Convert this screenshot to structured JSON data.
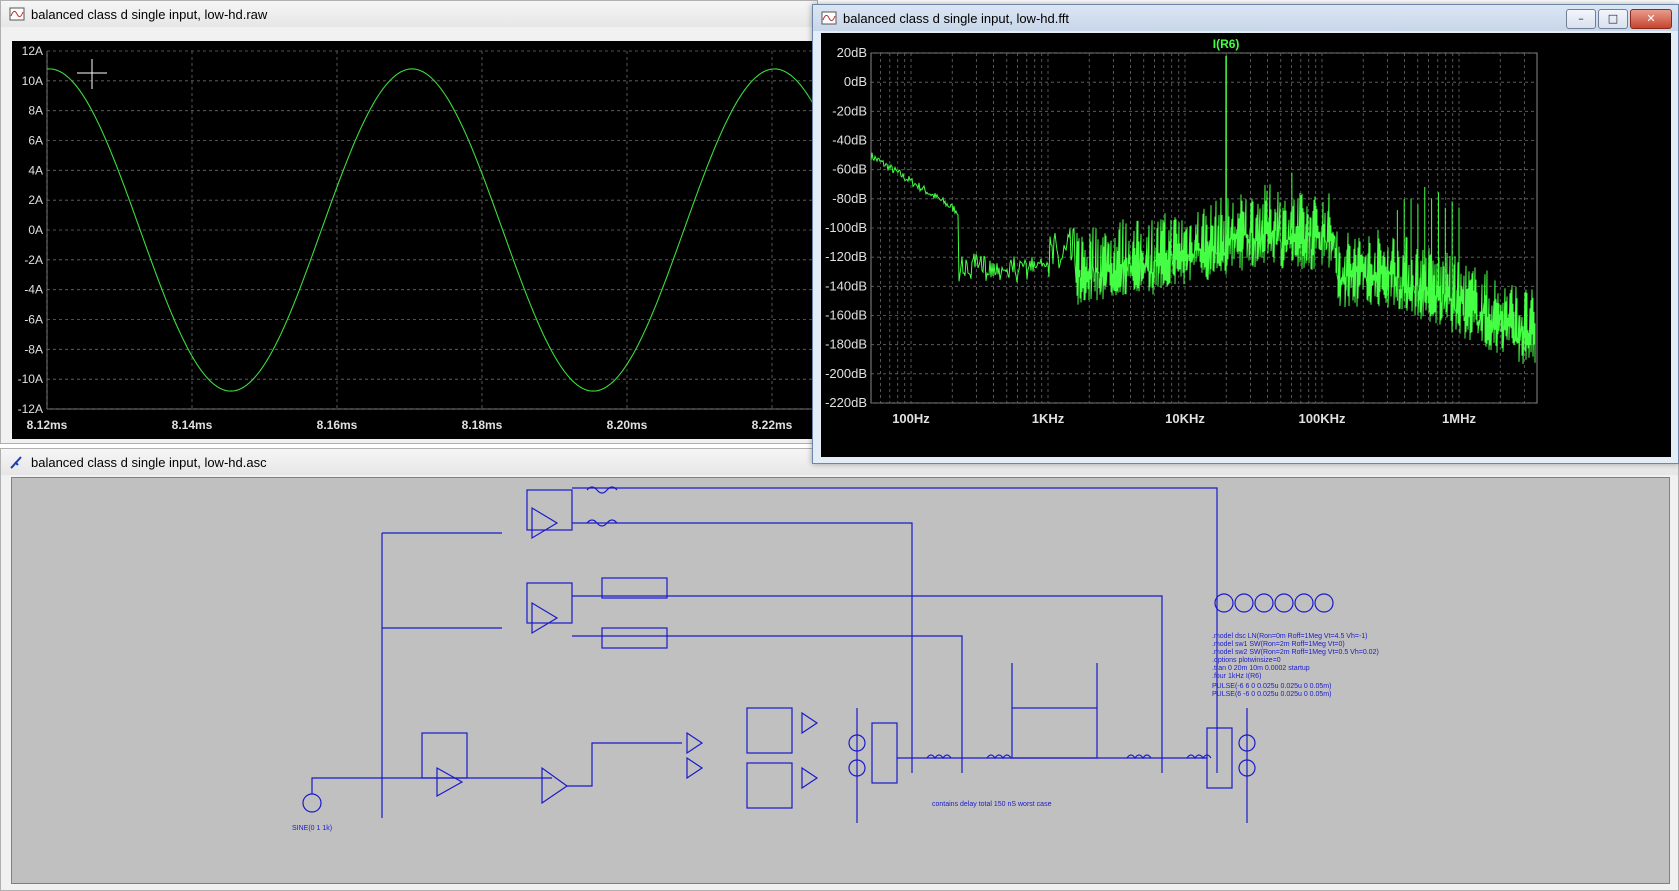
{
  "waveform_window": {
    "title": "balanced class d single input, low-hd.raw",
    "y_ticks": [
      "12A",
      "10A",
      "8A",
      "6A",
      "4A",
      "2A",
      "0A",
      "-2A",
      "-4A",
      "-6A",
      "-8A",
      "-10A",
      "-12A"
    ],
    "x_ticks": [
      "8.12ms",
      "8.14ms",
      "8.16ms",
      "8.18ms",
      "8.20ms",
      "8.22ms"
    ],
    "trace_color": "#3cdc3c"
  },
  "fft_window": {
    "title": "balanced class d single input, low-hd.fft",
    "trace_label": "I(R6)",
    "y_ticks": [
      "20dB",
      "0dB",
      "-20dB",
      "-40dB",
      "-60dB",
      "-80dB",
      "-100dB",
      "-120dB",
      "-140dB",
      "-160dB",
      "-180dB",
      "-200dB",
      "-220dB"
    ],
    "x_ticks": [
      "100Hz",
      "1KHz",
      "10KHz",
      "100KHz",
      "1MHz"
    ],
    "buttons": {
      "minimize": "–",
      "maximize": "□",
      "close": "✕"
    },
    "trace_color": "#44ff44"
  },
  "schematic_window": {
    "title": "balanced class d single input, low-hd.asc",
    "wire_color": "#1a1acc",
    "note": "contains delay total 150 nS worst case",
    "directives": [
      ".model dsc LN(Ron=0m Roff=1Meg Vt=4.5 Vh=-1)",
      ".model sw1 SW(Ron=2m Roff=1Meg Vt=0)",
      ".model sw2 SW(Ron=2m Roff=1Meg Vt=0.5 Vh=0.02)",
      ".options plotwinsize=0",
      ".tran 0 20m 10m 0.0002 startup",
      ".four 1kHz I(R6)"
    ],
    "pulse_lines": [
      "PULSE(-6 6 0 0.025u 0.025u 0 0.05m)",
      "PULSE(6 -6 0 0.025u 0.025u 0 0.05m)"
    ],
    "source_label": "SINE(0 1 1k)"
  }
}
